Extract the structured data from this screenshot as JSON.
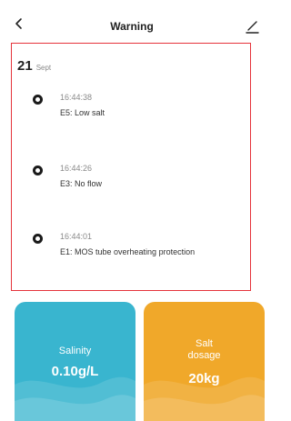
{
  "header": {
    "title": "Warning",
    "back_icon": "chevron-left-icon",
    "edit_icon": "pencil-icon"
  },
  "date": {
    "day": "21",
    "month": "Sept"
  },
  "events": [
    {
      "time": "16:44:38",
      "description": "E5:  Low salt"
    },
    {
      "time": "16:44:26",
      "description": "E3:  No flow"
    },
    {
      "time": "16:44:01",
      "description": "E1:  MOS tube overheating protection"
    }
  ],
  "cards": {
    "salinity": {
      "label": "Salinity",
      "value": "0.10g/L"
    },
    "salt_dosage": {
      "label_line1": "Salt",
      "label_line2": "dosage",
      "value": "20kg"
    }
  },
  "colors": {
    "highlight_border": "#e5333b",
    "salinity_card": "#39b5cf",
    "salt_card": "#f0a82a"
  }
}
